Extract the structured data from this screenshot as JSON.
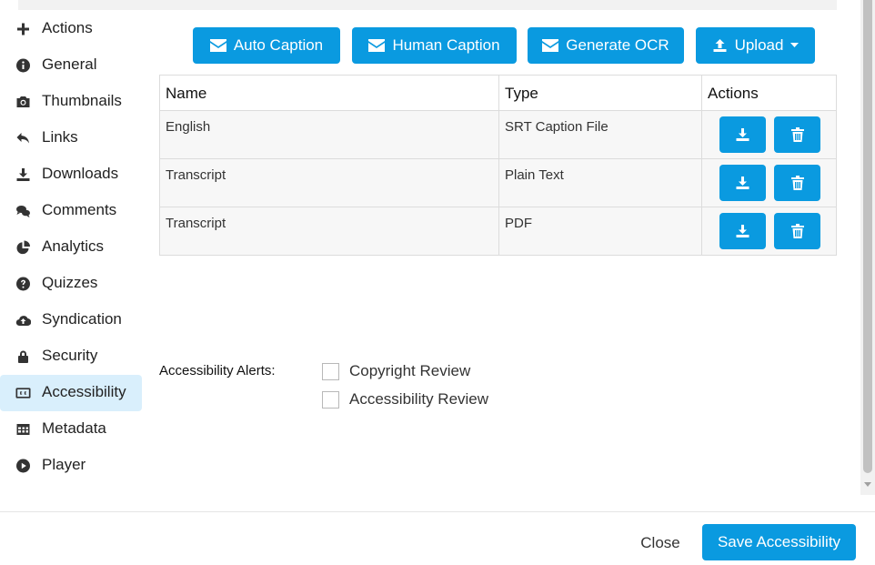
{
  "sidebar": {
    "items": [
      {
        "label": "Actions",
        "icon": "plus-icon"
      },
      {
        "label": "General",
        "icon": "info-icon"
      },
      {
        "label": "Thumbnails",
        "icon": "camera-icon"
      },
      {
        "label": "Links",
        "icon": "reply-icon"
      },
      {
        "label": "Downloads",
        "icon": "download-icon"
      },
      {
        "label": "Comments",
        "icon": "comments-icon"
      },
      {
        "label": "Analytics",
        "icon": "pie-chart-icon"
      },
      {
        "label": "Quizzes",
        "icon": "question-icon"
      },
      {
        "label": "Syndication",
        "icon": "cloud-upload-icon"
      },
      {
        "label": "Security",
        "icon": "lock-icon"
      },
      {
        "label": "Accessibility",
        "icon": "closed-caption-icon",
        "active": true
      },
      {
        "label": "Metadata",
        "icon": "table-icon"
      },
      {
        "label": "Player",
        "icon": "play-circle-icon"
      }
    ]
  },
  "toolbar": {
    "auto_caption": "Auto Caption",
    "human_caption": "Human Caption",
    "generate_ocr": "Generate OCR",
    "upload": "Upload"
  },
  "table": {
    "headers": {
      "name": "Name",
      "type": "Type",
      "actions": "Actions"
    },
    "rows": [
      {
        "name": "English",
        "type": "SRT Caption File"
      },
      {
        "name": "Transcript",
        "type": "Plain Text"
      },
      {
        "name": "Transcript",
        "type": "PDF"
      }
    ]
  },
  "alerts": {
    "label": "Accessibility Alerts:",
    "options": [
      {
        "label": "Copyright Review",
        "checked": false
      },
      {
        "label": "Accessibility Review",
        "checked": false
      }
    ]
  },
  "footer": {
    "close_label": "Close",
    "save_label": "Save Accessibility"
  },
  "colors": {
    "accent": "#0a9ae0",
    "active_nav_bg": "#d9effc"
  }
}
